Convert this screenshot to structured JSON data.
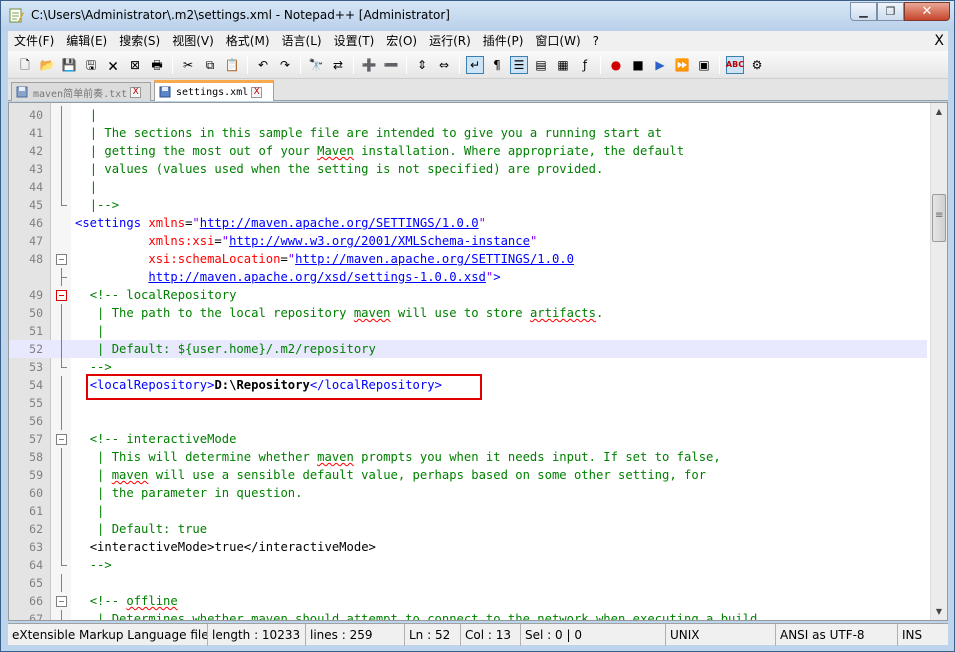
{
  "window": {
    "title": "C:\\Users\\Administrator\\.m2\\settings.xml - Notepad++ [Administrator]"
  },
  "menu": [
    "文件(F)",
    "编辑(E)",
    "搜索(S)",
    "视图(V)",
    "格式(M)",
    "语言(L)",
    "设置(T)",
    "宏(O)",
    "运行(R)",
    "插件(P)",
    "窗口(W)",
    "?"
  ],
  "menu_close": "X",
  "toolbar": [
    "new-file-icon",
    "open-file-icon",
    "save-icon",
    "save-all-icon",
    "close-icon",
    "close-all-icon",
    "print-icon",
    "cut-icon",
    "copy-icon",
    "paste-icon",
    "undo-icon",
    "redo-icon",
    "find-icon",
    "replace-icon",
    "zoom-in-icon",
    "zoom-out-icon",
    "sync-vertical-icon",
    "sync-horizontal-icon",
    "word-wrap-icon",
    "show-all-chars-icon",
    "indent-guide-icon",
    "user-language-icon",
    "document-map-icon",
    "function-list-icon",
    "record-macro-icon",
    "stop-macro-icon",
    "play-macro-icon",
    "run-macro-multiple-icon",
    "save-macro-icon",
    "spell-check-icon",
    "plugin-icon"
  ],
  "tabs": [
    {
      "label": "maven简单前奏.txt",
      "active": false,
      "close": "X"
    },
    {
      "label": "settings.xml",
      "active": true,
      "close": "X"
    }
  ],
  "editor": {
    "current_line": 52,
    "lines": [
      {
        "n": "40",
        "indent": "  ",
        "segments": [
          {
            "t": "|",
            "c": "com"
          }
        ]
      },
      {
        "n": "41",
        "indent": "  ",
        "segments": [
          {
            "t": "| The sections in this sample file are intended to give you a running start at",
            "c": "com"
          }
        ]
      },
      {
        "n": "42",
        "indent": "  ",
        "segments": [
          {
            "t": "| getting the most out of your ",
            "c": "com"
          },
          {
            "t": "Maven",
            "c": "com",
            "squig": true
          },
          {
            "t": " installation. Where appropriate, the default",
            "c": "com"
          }
        ]
      },
      {
        "n": "43",
        "indent": "  ",
        "segments": [
          {
            "t": "| values (values used when the setting is not specified) are provided.",
            "c": "com"
          }
        ]
      },
      {
        "n": "44",
        "indent": "  ",
        "segments": [
          {
            "t": "|",
            "c": "com"
          }
        ]
      },
      {
        "n": "45",
        "indent": "  ",
        "segments": [
          {
            "t": "|-->",
            "c": "com"
          }
        ]
      },
      {
        "n": "46",
        "indent": "",
        "segments": [
          {
            "t": "<settings ",
            "c": "tag"
          },
          {
            "t": "xmlns",
            "c": "attr"
          },
          {
            "t": "=",
            "c": "plain"
          },
          {
            "t": "\"",
            "c": "val"
          },
          {
            "t": "http://maven.apache.org/SETTINGS/1.0.0",
            "c": "url"
          },
          {
            "t": "\"",
            "c": "val"
          }
        ]
      },
      {
        "n": "47",
        "indent": "          ",
        "segments": [
          {
            "t": "xmlns:xsi",
            "c": "attr"
          },
          {
            "t": "=",
            "c": "plain"
          },
          {
            "t": "\"",
            "c": "val"
          },
          {
            "t": "http://www.w3.org/2001/XMLSchema-instance",
            "c": "url"
          },
          {
            "t": "\"",
            "c": "val"
          }
        ]
      },
      {
        "n": "48",
        "indent": "          ",
        "segments": [
          {
            "t": "xsi:schemaLocation",
            "c": "attr"
          },
          {
            "t": "=",
            "c": "plain"
          },
          {
            "t": "\"",
            "c": "val"
          },
          {
            "t": "http://maven.apache.org/SETTINGS/1.0.0",
            "c": "url"
          }
        ]
      },
      {
        "n": "",
        "indent": "          ",
        "segments": [
          {
            "t": "http://maven.apache.org/xsd/settings-1.0.0.xsd",
            "c": "url"
          },
          {
            "t": "\"",
            "c": "val"
          },
          {
            "t": ">",
            "c": "tag"
          }
        ]
      },
      {
        "n": "49",
        "indent": "  ",
        "segments": [
          {
            "t": "<!-- localRepository",
            "c": "com"
          }
        ]
      },
      {
        "n": "50",
        "indent": "   ",
        "segments": [
          {
            "t": "| The path to the local repository ",
            "c": "com"
          },
          {
            "t": "maven",
            "c": "com",
            "squig": true
          },
          {
            "t": " will use to store ",
            "c": "com"
          },
          {
            "t": "artifacts",
            "c": "com",
            "squig": true
          },
          {
            "t": ".",
            "c": "com"
          }
        ]
      },
      {
        "n": "51",
        "indent": "   ",
        "segments": [
          {
            "t": "|",
            "c": "com"
          }
        ]
      },
      {
        "n": "52",
        "indent": "   ",
        "segments": [
          {
            "t": "| Default: ${user.home}/.m2/repository",
            "c": "com"
          }
        ]
      },
      {
        "n": "53",
        "indent": "  ",
        "segments": [
          {
            "t": "-->",
            "c": "com"
          }
        ]
      },
      {
        "n": "54",
        "indent": "  ",
        "segments": [
          {
            "t": "<localRepository>",
            "c": "tag"
          },
          {
            "t": "D:\\Repository",
            "c": "txt"
          },
          {
            "t": "</localRepository>",
            "c": "tag"
          }
        ]
      },
      {
        "n": "55",
        "indent": "",
        "segments": []
      },
      {
        "n": "56",
        "indent": "",
        "segments": []
      },
      {
        "n": "57",
        "indent": "  ",
        "segments": [
          {
            "t": "<!-- interactiveMode",
            "c": "com"
          }
        ]
      },
      {
        "n": "58",
        "indent": "   ",
        "segments": [
          {
            "t": "| This will determine whether ",
            "c": "com"
          },
          {
            "t": "maven",
            "c": "com",
            "squig": true
          },
          {
            "t": " prompts you when it needs input. If set to false,",
            "c": "com"
          }
        ]
      },
      {
        "n": "59",
        "indent": "   ",
        "segments": [
          {
            "t": "| ",
            "c": "com"
          },
          {
            "t": "maven",
            "c": "com",
            "squig": true
          },
          {
            "t": " will use a sensible default value, perhaps based on some other setting, for",
            "c": "com"
          }
        ]
      },
      {
        "n": "60",
        "indent": "   ",
        "segments": [
          {
            "t": "| the parameter in question.",
            "c": "com"
          }
        ]
      },
      {
        "n": "61",
        "indent": "   ",
        "segments": [
          {
            "t": "|",
            "c": "com"
          }
        ]
      },
      {
        "n": "62",
        "indent": "   ",
        "segments": [
          {
            "t": "| Default: true",
            "c": "com"
          }
        ]
      },
      {
        "n": "63",
        "indent": "  ",
        "segments": [
          {
            "t": "<interactiveMode>",
            "c": "plain"
          },
          {
            "t": "true",
            "c": "plain"
          },
          {
            "t": "</interactiveMode>",
            "c": "plain"
          }
        ]
      },
      {
        "n": "64",
        "indent": "  ",
        "segments": [
          {
            "t": "-->",
            "c": "com"
          }
        ]
      },
      {
        "n": "65",
        "indent": "",
        "segments": []
      },
      {
        "n": "66",
        "indent": "  ",
        "segments": [
          {
            "t": "<!-- ",
            "c": "com"
          },
          {
            "t": "offline",
            "c": "com",
            "squig": true
          }
        ]
      },
      {
        "n": "67",
        "indent": "   ",
        "segments": [
          {
            "t": "| Determines whether maven should attempt to connect to the network when executing a build.",
            "c": "com"
          }
        ]
      }
    ]
  },
  "statusbar": {
    "type": "eXtensible Markup Language file",
    "length": "length : 10233",
    "lines": "lines : 259",
    "ln": "Ln : 52",
    "col": "Col : 13",
    "sel": "Sel : 0 | 0",
    "eol": "UNIX",
    "encoding": "ANSI as UTF-8",
    "mode": "INS"
  }
}
